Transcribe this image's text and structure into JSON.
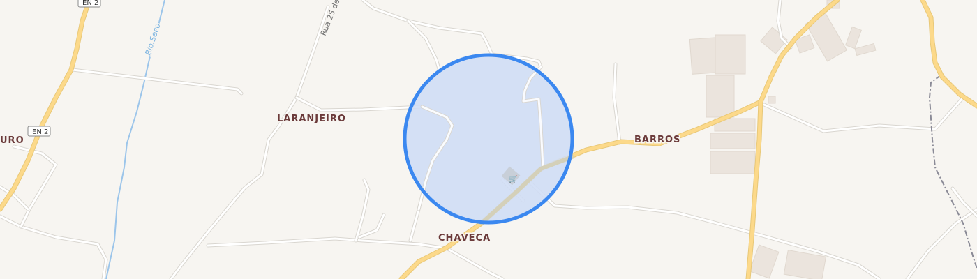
{
  "map": {
    "places": {
      "laranjeiro": "LARANJEIRO",
      "barros": "BARROS",
      "chaveca": "CHAVECA",
      "left_partial": "URO"
    },
    "streets": {
      "rua": "Rua 25 de"
    },
    "water": {
      "river": "Rio Seco"
    },
    "shields": {
      "top": "EN 2",
      "mid": "EN 2"
    },
    "location_marker": {
      "fill_color": "#cfddf5",
      "stroke_color": "#3b88f0"
    },
    "icons": {
      "shop": "shopping-cart-icon"
    }
  }
}
